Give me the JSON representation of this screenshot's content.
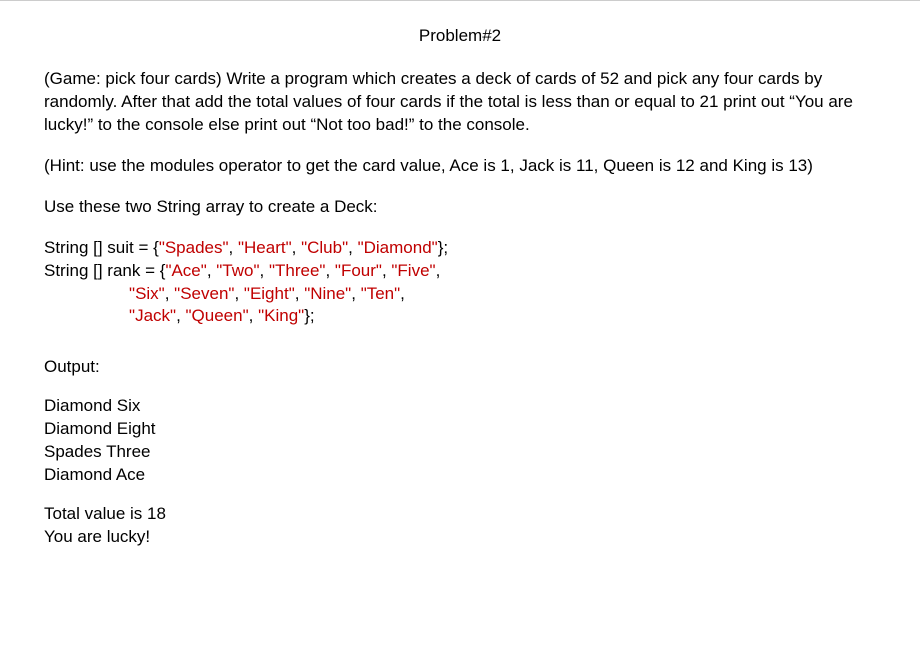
{
  "title": "Problem#2",
  "paragraphs": {
    "p1": "(Game: pick four cards) Write a program which creates a deck of cards of 52 and pick any four cards by randomly. After that add the total values of four cards if the total is less than or equal to 21 print out “You are lucky!” to the console else print out “Not too bad!” to the console.",
    "p2": "(Hint: use the modules operator to get the card value, Ace is 1, Jack is 11, Queen is 12 and King is 13)",
    "p3": "Use these two String array to create a Deck:"
  },
  "code": {
    "line1_pre": "String [] suit = {",
    "line1_s1": "\"Spades\"",
    "line1_c1": ", ",
    "line1_s2": "\"Heart\"",
    "line1_c2": ", ",
    "line1_s3": "\"Club\"",
    "line1_c3": ", ",
    "line1_s4": "\"Diamond\"",
    "line1_post": "};",
    "line2_pre": "String [] rank = {",
    "line2_s1": "\"Ace\"",
    "line2_c1": ", ",
    "line2_s2": "\"Two\"",
    "line2_c2": ", ",
    "line2_s3": "\"Three\"",
    "line2_c3": ", ",
    "line2_s4": "\"Four\"",
    "line2_c4": ", ",
    "line2_s5": "\"Five\"",
    "line2_post": ",",
    "line3_indent": "                  ",
    "line3_s1": "\"Six\"",
    "line3_c1": ", ",
    "line3_s2": "\"Seven\"",
    "line3_c2": ", ",
    "line3_s3": "\"Eight\"",
    "line3_c3": ", ",
    "line3_s4": "\"Nine\"",
    "line3_c4": ", ",
    "line3_s5": "\"Ten\"",
    "line3_post": ",",
    "line4_indent": "                  ",
    "line4_s1": "\"Jack\"",
    "line4_c1": ", ",
    "line4_s2": "\"Queen\"",
    "line4_c2": ", ",
    "line4_s3": "\"King\"",
    "line4_post": "};"
  },
  "output": {
    "label": "Output:",
    "cards": "Diamond Six\nDiamond Eight\nSpades Three\nDiamond Ace",
    "result": "Total value is 18\nYou are lucky!"
  }
}
